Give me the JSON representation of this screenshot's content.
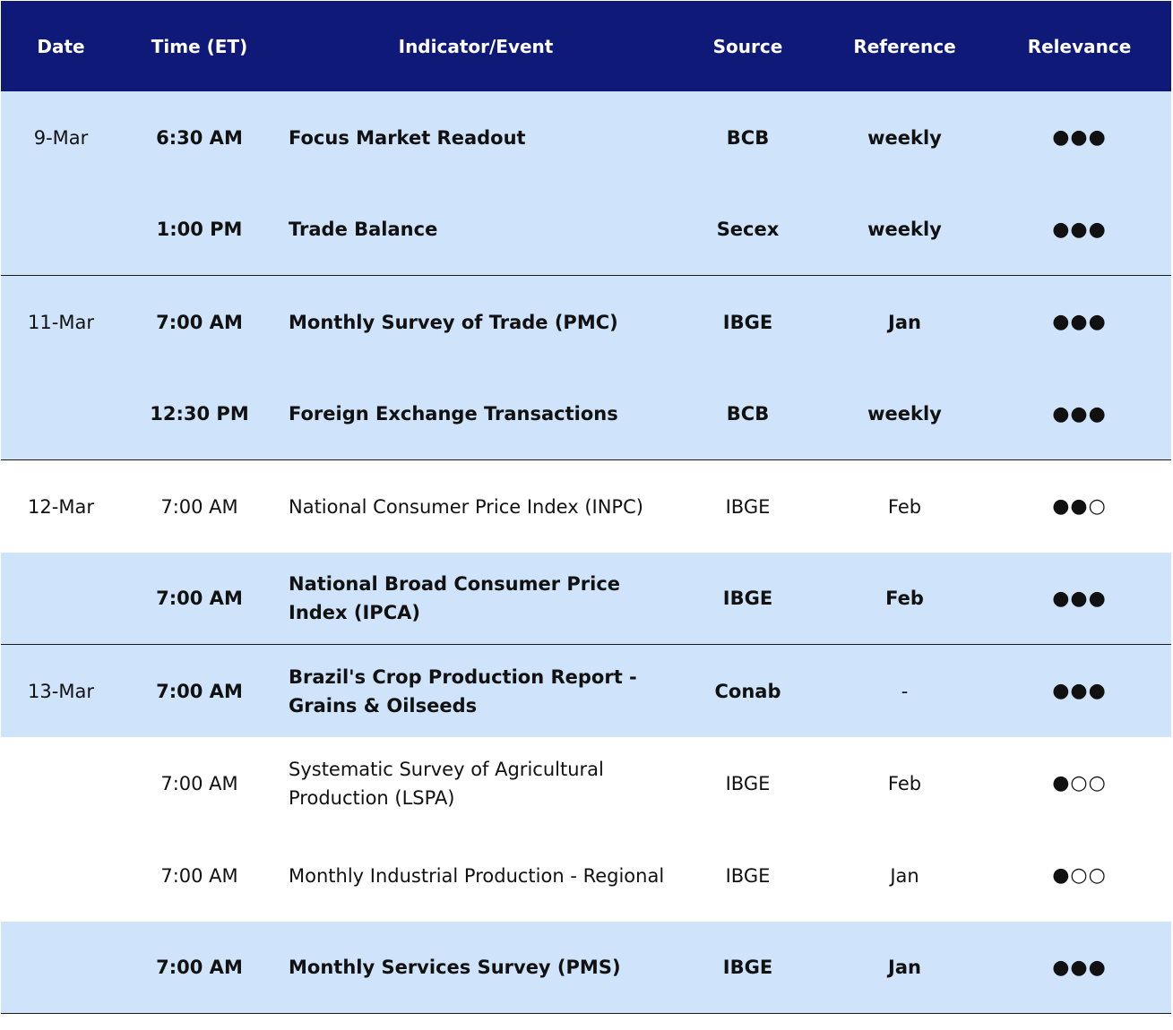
{
  "header": {
    "date": "Date",
    "time": "Time (ET)",
    "indicator": "Indicator/Event",
    "source": "Source",
    "reference": "Reference",
    "relevance": "Relevance"
  },
  "rows": [
    {
      "date": "9-Mar",
      "time": "6:30 AM",
      "indicator": "Focus Market Readout",
      "source": "BCB",
      "reference": "weekly",
      "relevance": "●●●"
    },
    {
      "date": "",
      "time": "1:00 PM",
      "indicator": "Trade Balance",
      "source": "Secex",
      "reference": "weekly",
      "relevance": "●●●"
    },
    {
      "date": "11-Mar",
      "time": "7:00 AM",
      "indicator": "Monthly Survey of Trade (PMC)",
      "source": "IBGE",
      "reference": "Jan",
      "relevance": "●●●"
    },
    {
      "date": "",
      "time": "12:30 PM",
      "indicator": "Foreign Exchange Transactions",
      "source": "BCB",
      "reference": "weekly",
      "relevance": "●●●"
    },
    {
      "date": "12-Mar",
      "time": "7:00 AM",
      "indicator": "National Consumer Price Index (INPC)",
      "source": "IBGE",
      "reference": "Feb",
      "relevance": "●●○"
    },
    {
      "date": "",
      "time": "7:00 AM",
      "indicator": "National Broad Consumer Price Index (IPCA)",
      "source": "IBGE",
      "reference": "Feb",
      "relevance": "●●●"
    },
    {
      "date": "13-Mar",
      "time": "7:00 AM",
      "indicator": "Brazil's Crop Production Report - Grains & Oilseeds",
      "source": "Conab",
      "reference": "-",
      "relevance": "●●●"
    },
    {
      "date": "",
      "time": "7:00 AM",
      "indicator": "Systematic Survey of Agricultural Production (LSPA)",
      "source": "IBGE",
      "reference": "Feb",
      "relevance": "●○○"
    },
    {
      "date": "",
      "time": "7:00 AM",
      "indicator": "Monthly Industrial Production - Regional",
      "source": "IBGE",
      "reference": "Jan",
      "relevance": "●○○"
    },
    {
      "date": "",
      "time": "7:00 AM",
      "indicator": "Monthly Services Survey (PMS)",
      "source": "IBGE",
      "reference": "Jan",
      "relevance": "●●●"
    }
  ]
}
